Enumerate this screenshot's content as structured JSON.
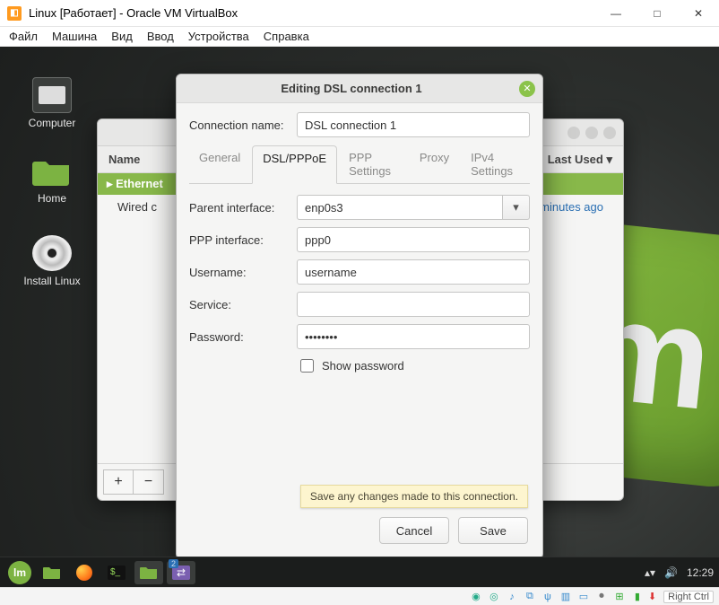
{
  "vb": {
    "title": "Linux [Работает] - Oracle VM VirtualBox",
    "menu": {
      "file": "Файл",
      "machine": "Машина",
      "view": "Вид",
      "input": "Ввод",
      "devices": "Устройства",
      "help": "Справка"
    },
    "hostkey": "Right Ctrl"
  },
  "desktop": {
    "icons": {
      "computer": "Computer",
      "home": "Home",
      "install": "Install Linux"
    }
  },
  "taskbar": {
    "clock": "12:29"
  },
  "nc": {
    "col_name": "Name",
    "col_last": "Last Used ▾",
    "section": "Ethernet",
    "row_name": "Wired c",
    "row_last": "minutes ago",
    "add": "+",
    "remove": "−"
  },
  "dlg": {
    "title": "Editing DSL connection 1",
    "conn_name_label": "Connection name:",
    "conn_name_value": "DSL connection 1",
    "tabs": {
      "general": "General",
      "dsl": "DSL/PPPoE",
      "ppp": "PPP Settings",
      "proxy": "Proxy",
      "ipv4": "IPv4 Settings"
    },
    "labels": {
      "parent_if": "Parent interface:",
      "ppp_if": "PPP interface:",
      "username": "Username:",
      "service": "Service:",
      "password": "Password:",
      "show_pw": "Show password"
    },
    "values": {
      "parent_if": "enp0s3",
      "ppp_if": "ppp0",
      "username": "username",
      "service": "",
      "password": "••••••••"
    },
    "actions": {
      "cancel": "Cancel",
      "save": "Save"
    },
    "tooltip": "Save any changes made to this connection."
  }
}
